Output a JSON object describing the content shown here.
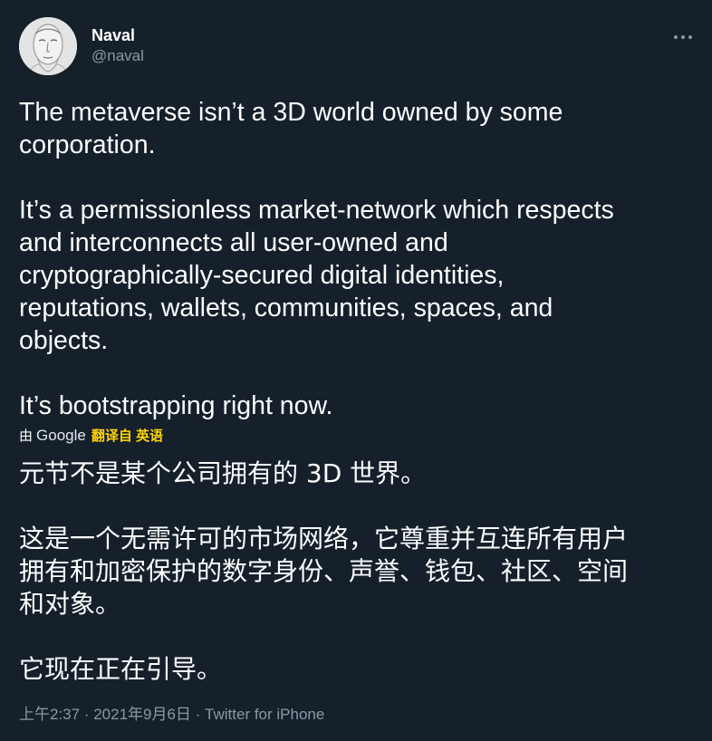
{
  "author": {
    "display_name": "Naval",
    "handle": "@naval"
  },
  "tweet": {
    "paragraphs": [
      "The metaverse isn’t a 3D world owned by some corporation.",
      "It’s a permissionless market-network which respects and interconnects all user-owned and cryptographically-secured digital identities, reputations, wallets, communities, spaces, and objects.",
      "It’s bootstrapping right now."
    ],
    "paragraph_lines": [
      [
        "The metaverse isn’t a 3D world owned by some",
        "corporation."
      ],
      [
        "It’s a permissionless market-network which respects",
        "and interconnects all user-owned and",
        "cryptographically-secured digital identities,",
        "reputations, wallets, communities, spaces, and",
        "objects."
      ],
      [
        "It’s bootstrapping right now."
      ]
    ]
  },
  "translation": {
    "by_label": "由",
    "provider": "Google",
    "link_label": "翻译自 英语",
    "lines": [
      [
        "元节不是某个公司拥有的 3D 世界。"
      ],
      [
        "这是一个无需许可的市场网络，它尊重并互连所有用户",
        "拥有和加密保护的数字身份、声誉、钱包、社区、空间",
        "和对象。"
      ],
      [
        "它现在正在引导。"
      ]
    ]
  },
  "footer": {
    "time": "上午2:37",
    "separator1": " · ",
    "date": "2021年9月6日",
    "separator2": " · ",
    "source": "Twitter for iPhone"
  },
  "icons": {
    "more": "more-horizontal-icon"
  },
  "colors": {
    "background": "#15202b",
    "text": "#ffffff",
    "secondary": "#8b98a5",
    "translate_link": "#ffd400"
  }
}
